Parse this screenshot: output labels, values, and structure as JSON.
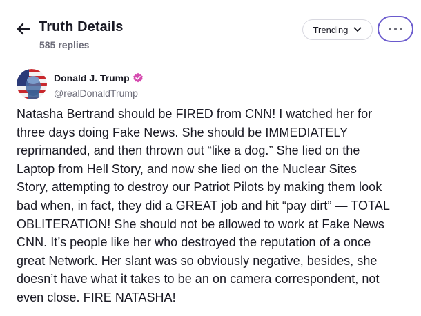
{
  "header": {
    "title": "Truth Details",
    "replies": "585 replies",
    "back_icon": "arrow-left-icon",
    "sort_label": "Trending",
    "sort_icon": "chevron-down-icon",
    "more_icon": "ellipsis-icon"
  },
  "post": {
    "author_name": "Donald J. Trump",
    "author_handle": "@realDonaldTrump",
    "verified_icon": "verified-badge-icon",
    "body": "Natasha Bertrand should be FIRED from CNN! I watched her for\nthree days doing Fake News. She should be IMMEDIATELY\nreprimanded, and then thrown out “like a dog.” She lied on the\nLaptop from Hell Story, and now she lied on the Nuclear Sites\nStory, attempting to destroy our Patriot Pilots by making them look\nbad when, in fact, they did a GREAT job and hit “pay dirt” — TOTAL\nOBLITERATION! She should not be allowed to work at Fake News\nCNN. It’s people like her who destroyed the reputation of a once\ngreat Network. Her slant was so obviously negative, besides, she\ndoesn’t have what it takes to be an on camera correspondent, not\neven close. FIRE NATASHA!"
  },
  "colors": {
    "accent": "#6a5acd",
    "verified": "#d64bb0",
    "text_primary": "#1a1a24",
    "text_secondary": "#6b6b78",
    "border": "#d8d8e0"
  }
}
